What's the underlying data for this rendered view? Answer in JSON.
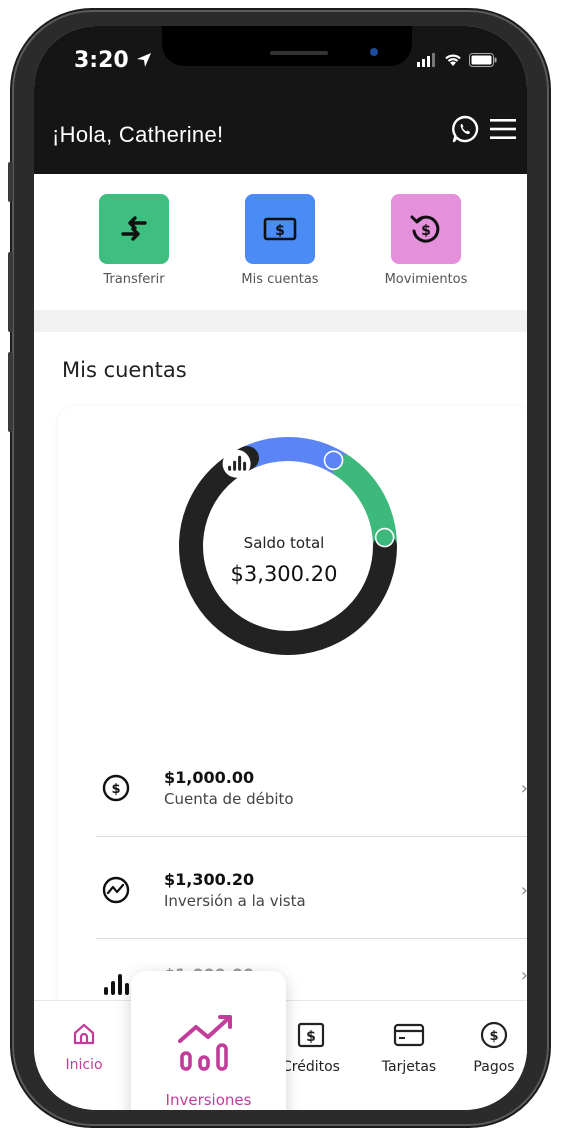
{
  "status": {
    "time": "3:20"
  },
  "header": {
    "greeting": "¡Hola, Catherine!"
  },
  "quick_actions": [
    {
      "label": "Transferir",
      "icon": "transfer-arrows-icon",
      "color": "#3fbf7f"
    },
    {
      "label": "Mis cuentas",
      "icon": "money-bill-icon",
      "color": "#4a8cf4"
    },
    {
      "label": "Movimientos",
      "icon": "history-dollar-icon",
      "color": "#e490da"
    }
  ],
  "section_title": "Mis cuentas",
  "balance": {
    "label": "Saldo total",
    "amount": "$3,300.20",
    "segments": [
      {
        "name": "Cuenta de débito",
        "value": 1000.0,
        "color": "#5b85f4"
      },
      {
        "name": "Inversión a la vista",
        "value": 1300.2,
        "color": "#3db97c"
      },
      {
        "name": "Inversión",
        "value": 1000.0,
        "color": "#222222"
      }
    ]
  },
  "accounts": [
    {
      "amount": "$1,000.00",
      "name": "Cuenta de débito",
      "icon": "dollar-circle-icon"
    },
    {
      "amount": "$1,300.20",
      "name": "Inversión a la vista",
      "icon": "growth-circle-icon"
    },
    {
      "amount": "$1,000.00",
      "name": "",
      "icon": "bars-chart-icon"
    }
  ],
  "tabs": [
    {
      "label": "Inicio",
      "icon": "home-icon",
      "active": true
    },
    {
      "label": "Inversiones",
      "icon": "investment-chart-icon"
    },
    {
      "label": "Créditos",
      "icon": "credit-dollar-icon"
    },
    {
      "label": "Tarjetas",
      "icon": "card-icon"
    },
    {
      "label": "Pagos",
      "icon": "pay-circle-icon"
    }
  ],
  "colors": {
    "accent": "#c23c9a",
    "header_bg": "#151515"
  }
}
